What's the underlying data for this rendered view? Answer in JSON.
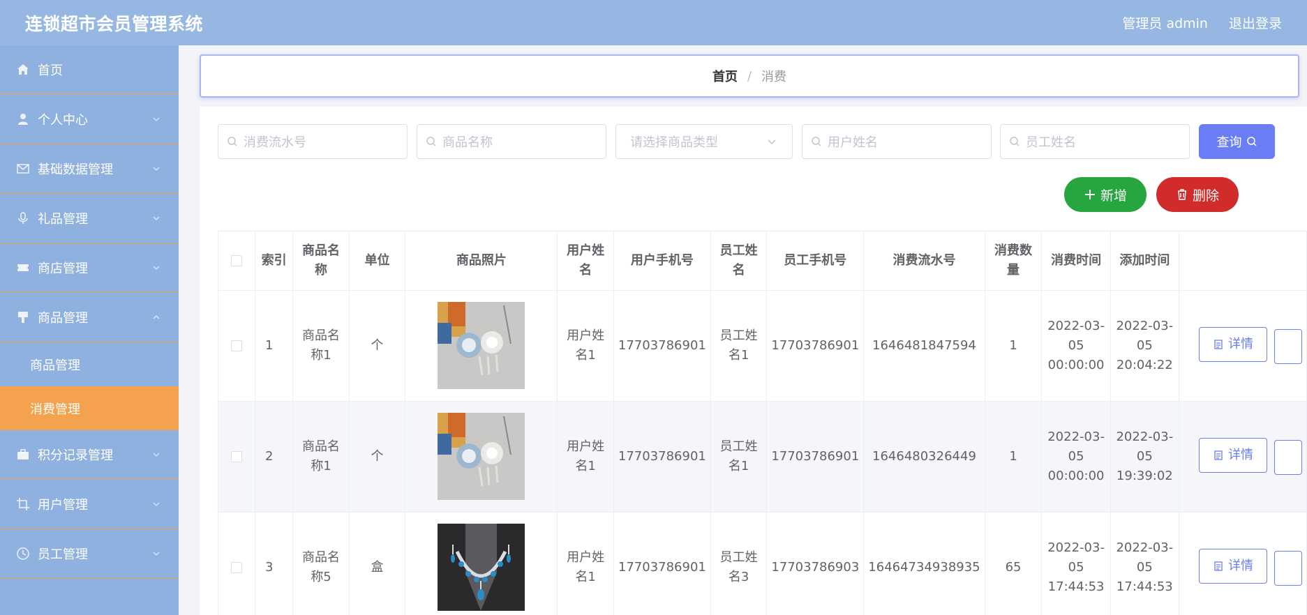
{
  "header": {
    "title": "连锁超市会员管理系统",
    "user_label": "管理员 admin",
    "logout_label": "退出登录"
  },
  "sidebar": {
    "items": [
      {
        "label": "首页",
        "icon": "home-icon",
        "chevron": false
      },
      {
        "label": "个人中心",
        "icon": "user-icon",
        "chevron": true
      },
      {
        "label": "基础数据管理",
        "icon": "mail-icon",
        "chevron": true
      },
      {
        "label": "礼品管理",
        "icon": "microphone-icon",
        "chevron": true
      },
      {
        "label": "商店管理",
        "icon": "ticket-icon",
        "chevron": true
      },
      {
        "label": "商品管理",
        "icon": "brush-icon",
        "chevron": true,
        "expanded": true
      }
    ],
    "sub_items": [
      {
        "label": "商品管理",
        "active": false
      },
      {
        "label": "消费管理",
        "active": true
      }
    ],
    "items_after": [
      {
        "label": "积分记录管理",
        "icon": "briefcase-icon",
        "chevron": true
      },
      {
        "label": "用户管理",
        "icon": "crop-icon",
        "chevron": true
      },
      {
        "label": "员工管理",
        "icon": "clock-icon",
        "chevron": true
      }
    ]
  },
  "breadcrumb": {
    "home": "首页",
    "separator": "/",
    "current": "消费"
  },
  "search": {
    "serial_placeholder": "消费流水号",
    "product_placeholder": "商品名称",
    "type_placeholder": "请选择商品类型",
    "user_placeholder": "用户姓名",
    "staff_placeholder": "员工姓名",
    "query_label": "查询"
  },
  "actions": {
    "add_label": "新增",
    "delete_label": "删除"
  },
  "table": {
    "columns": [
      "索引",
      "商品名称",
      "单位",
      "商品照片",
      "用户姓名",
      "用户手机号",
      "员工姓名",
      "员工手机号",
      "消费流水号",
      "消费数量",
      "消费时间",
      "添加时间"
    ],
    "detail_label": "详情",
    "rows": [
      {
        "index": "1",
        "product": "商品名称1",
        "unit": "个",
        "photo": "brooch",
        "user": "用户姓名1",
        "user_phone": "17703786901",
        "staff": "员工姓名1",
        "staff_phone": "17703786901",
        "serial": "1646481847594",
        "qty": "1",
        "consume_time": "2022-03-05 00:00:00",
        "add_time": "2022-03-05 20:04:22"
      },
      {
        "index": "2",
        "product": "商品名称1",
        "unit": "个",
        "photo": "brooch",
        "user": "用户姓名1",
        "user_phone": "17703786901",
        "staff": "员工姓名1",
        "staff_phone": "17703786901",
        "serial": "1646480326449",
        "qty": "1",
        "consume_time": "2022-03-05 00:00:00",
        "add_time": "2022-03-05 19:39:02"
      },
      {
        "index": "3",
        "product": "商品名称5",
        "unit": "盒",
        "photo": "necklace",
        "user": "用户姓名1",
        "user_phone": "17703786901",
        "staff": "员工姓名3",
        "staff_phone": "17703786903",
        "serial": "16464734938935",
        "qty": "65",
        "consume_time": "2022-03-05 17:44:53",
        "add_time": "2022-03-05 17:44:53"
      }
    ]
  },
  "colors": {
    "topbar": "#96b7e1",
    "sidebar": "#8fb1df",
    "active": "#f4a24e",
    "primary": "#6a7df5",
    "success": "#27a53f",
    "danger": "#d12b2b"
  }
}
